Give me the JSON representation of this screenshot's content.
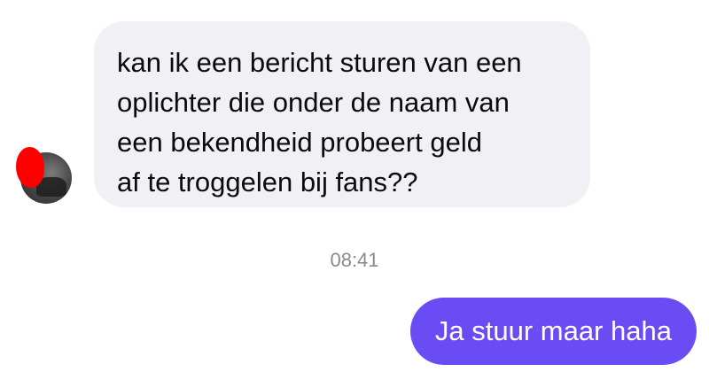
{
  "conversation": {
    "incoming": {
      "text": "kan ik een bericht sturen van een\noplichter die onder de naam van\neen bekendheid probeert  geld\naf te troggelen bij fans??"
    },
    "timestamp": "08:41",
    "outgoing": {
      "text": "Ja stuur maar haha"
    }
  },
  "colors": {
    "incoming_bubble": "#f0f0f5",
    "outgoing_bubble": "#6a4cf5",
    "timestamp_text": "#8a8a8e",
    "redaction": "#ff0000"
  }
}
